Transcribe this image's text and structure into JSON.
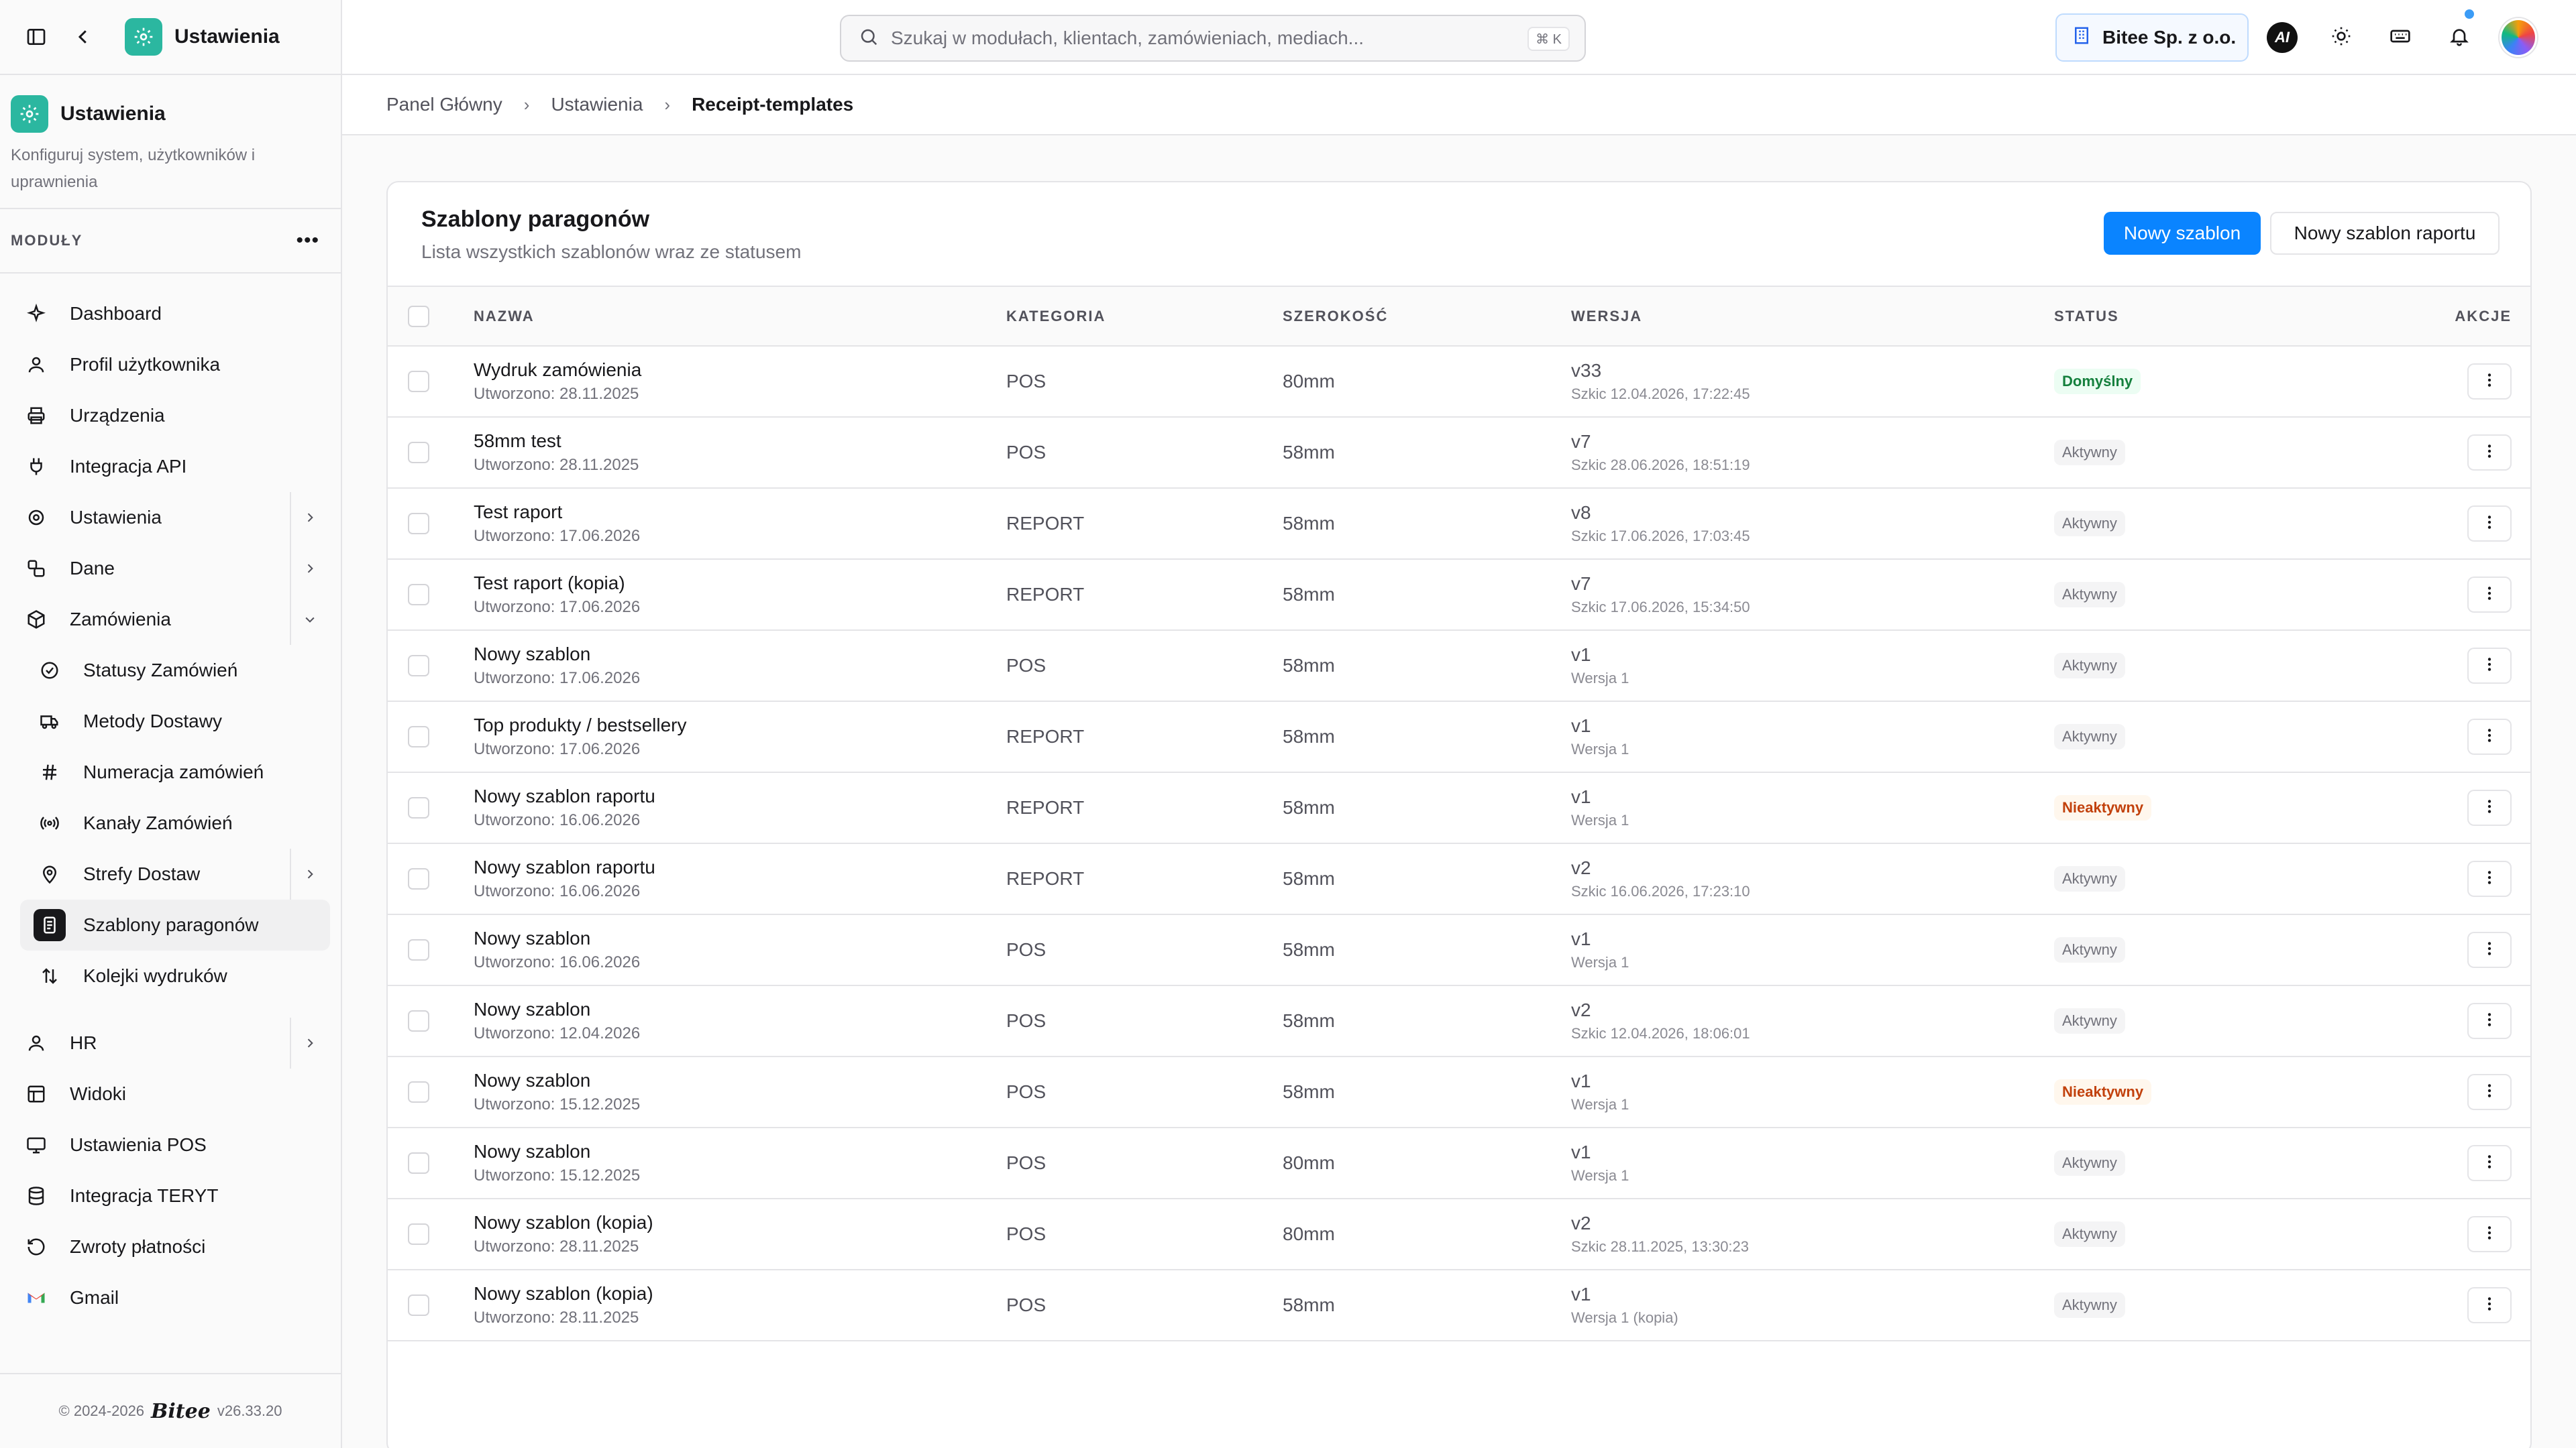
{
  "sidebar": {
    "app_title": "Ustawienia",
    "module_title": "Ustawienia",
    "module_desc": "Konfiguruj system, użytkowników i uprawnienia",
    "modules_label": "MODUŁY",
    "items": [
      {
        "label": "Dashboard",
        "icon": "sparkle-icon"
      },
      {
        "label": "Profil użytkownika",
        "icon": "user-icon"
      },
      {
        "label": "Urządzenia",
        "icon": "printer-icon"
      },
      {
        "label": "Integracja API",
        "icon": "plug-icon"
      },
      {
        "label": "Ustawienia",
        "icon": "gear-icon"
      },
      {
        "label": "Dane",
        "icon": "data-icon"
      },
      {
        "label": "Zamówienia",
        "icon": "box-icon"
      },
      {
        "label": "Statusy Zamówień",
        "icon": "check-circle-icon"
      },
      {
        "label": "Metody Dostawy",
        "icon": "truck-icon"
      },
      {
        "label": "Numeracja zamówień",
        "icon": "hash-icon"
      },
      {
        "label": "Kanały Zamówień",
        "icon": "broadcast-icon"
      },
      {
        "label": "Strefy Dostaw",
        "icon": "map-pin-icon"
      },
      {
        "label": "Szablony paragonów",
        "icon": "receipt-icon"
      },
      {
        "label": "Kolejki wydruków",
        "icon": "arrows-updown-icon"
      },
      {
        "label": "HR",
        "icon": "user-icon"
      },
      {
        "label": "Widoki",
        "icon": "layout-icon"
      },
      {
        "label": "Ustawienia POS",
        "icon": "monitor-icon"
      },
      {
        "label": "Integracja TERYT",
        "icon": "database-icon"
      },
      {
        "label": "Zwroty płatności",
        "icon": "refund-icon"
      },
      {
        "label": "Gmail",
        "icon": "gmail-icon"
      }
    ],
    "footer_copy": "© 2024-2026",
    "footer_brand": "Bitee",
    "footer_version": "v26.33.20"
  },
  "topbar": {
    "search_placeholder": "Szukaj w modułach, klientach, zamówieniach, mediach...",
    "search_shortcut": "⌘ K",
    "org_name": "Bitee Sp. z o.o.",
    "ai_label": "AI"
  },
  "breadcrumb": [
    "Panel Główny",
    "Ustawienia",
    "Receipt-templates"
  ],
  "card": {
    "title": "Szablony paragonów",
    "subtitle": "Lista wszystkich szablonów wraz ze statusem",
    "new_button": "Nowy szablon",
    "new_report_button": "Nowy szablon raportu"
  },
  "table": {
    "columns": [
      "NAZWA",
      "KATEGORIA",
      "SZEROKOŚĆ",
      "WERSJA",
      "STATUS",
      "AKCJE"
    ],
    "rows": [
      {
        "name": "Wydruk zamówienia",
        "created": "Utworzono: 28.11.2025",
        "category": "POS",
        "width": "80mm",
        "version": "v33",
        "version_note": "Szkic 12.04.2026, 17:22:45",
        "status": "Domyślny",
        "status_kind": "default"
      },
      {
        "name": "58mm test",
        "created": "Utworzono: 28.11.2025",
        "category": "POS",
        "width": "58mm",
        "version": "v7",
        "version_note": "Szkic 28.06.2026, 18:51:19",
        "status": "Aktywny",
        "status_kind": "active"
      },
      {
        "name": "Test raport",
        "created": "Utworzono: 17.06.2026",
        "category": "REPORT",
        "width": "58mm",
        "version": "v8",
        "version_note": "Szkic 17.06.2026, 17:03:45",
        "status": "Aktywny",
        "status_kind": "active"
      },
      {
        "name": "Test raport (kopia)",
        "created": "Utworzono: 17.06.2026",
        "category": "REPORT",
        "width": "58mm",
        "version": "v7",
        "version_note": "Szkic 17.06.2026, 15:34:50",
        "status": "Aktywny",
        "status_kind": "active"
      },
      {
        "name": "Nowy szablon",
        "created": "Utworzono: 17.06.2026",
        "category": "POS",
        "width": "58mm",
        "version": "v1",
        "version_note": "Wersja 1",
        "status": "Aktywny",
        "status_kind": "active"
      },
      {
        "name": "Top produkty / bestsellery",
        "created": "Utworzono: 17.06.2026",
        "category": "REPORT",
        "width": "58mm",
        "version": "v1",
        "version_note": "Wersja 1",
        "status": "Aktywny",
        "status_kind": "active"
      },
      {
        "name": "Nowy szablon raportu",
        "created": "Utworzono: 16.06.2026",
        "category": "REPORT",
        "width": "58mm",
        "version": "v1",
        "version_note": "Wersja 1",
        "status": "Nieaktywny",
        "status_kind": "inactive"
      },
      {
        "name": "Nowy szablon raportu",
        "created": "Utworzono: 16.06.2026",
        "category": "REPORT",
        "width": "58mm",
        "version": "v2",
        "version_note": "Szkic 16.06.2026, 17:23:10",
        "status": "Aktywny",
        "status_kind": "active"
      },
      {
        "name": "Nowy szablon",
        "created": "Utworzono: 16.06.2026",
        "category": "POS",
        "width": "58mm",
        "version": "v1",
        "version_note": "Wersja 1",
        "status": "Aktywny",
        "status_kind": "active"
      },
      {
        "name": "Nowy szablon",
        "created": "Utworzono: 12.04.2026",
        "category": "POS",
        "width": "58mm",
        "version": "v2",
        "version_note": "Szkic 12.04.2026, 18:06:01",
        "status": "Aktywny",
        "status_kind": "active"
      },
      {
        "name": "Nowy szablon",
        "created": "Utworzono: 15.12.2025",
        "category": "POS",
        "width": "58mm",
        "version": "v1",
        "version_note": "Wersja 1",
        "status": "Nieaktywny",
        "status_kind": "inactive"
      },
      {
        "name": "Nowy szablon",
        "created": "Utworzono: 15.12.2025",
        "category": "POS",
        "width": "80mm",
        "version": "v1",
        "version_note": "Wersja 1",
        "status": "Aktywny",
        "status_kind": "active"
      },
      {
        "name": "Nowy szablon (kopia)",
        "created": "Utworzono: 28.11.2025",
        "category": "POS",
        "width": "80mm",
        "version": "v2",
        "version_note": "Szkic 28.11.2025, 13:30:23",
        "status": "Aktywny",
        "status_kind": "active"
      },
      {
        "name": "Nowy szablon (kopia)",
        "created": "Utworzono: 28.11.2025",
        "category": "POS",
        "width": "58mm",
        "version": "v1",
        "version_note": "Wersja 1 (kopia)",
        "status": "Aktywny",
        "status_kind": "active"
      }
    ]
  },
  "colors": {
    "accent": "#0a84ff",
    "brand_teal": "#2bb7a0",
    "status_default": "#15803d",
    "status_inactive": "#c2410c"
  }
}
